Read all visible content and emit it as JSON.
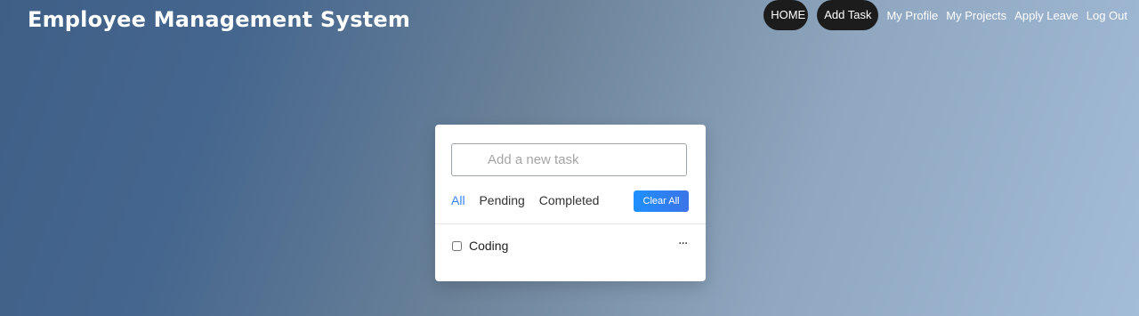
{
  "header": {
    "title": "Employee Management System",
    "nav": {
      "home": "HOME",
      "add_task": "Add Task",
      "my_profile": "My Profile",
      "my_projects": "My Projects",
      "apply_leave": "Apply Leave",
      "log_out": "Log Out"
    }
  },
  "todo": {
    "input_placeholder": "Add a new task",
    "filters": [
      "All",
      "Pending",
      "Completed"
    ],
    "active_filter": "All",
    "clear_label": "Clear All",
    "tasks": [
      {
        "label": "Coding",
        "checked": false
      }
    ],
    "menu_icon": "ellipsis-icon"
  },
  "colors": {
    "accent": "#3b82f6",
    "nav_pill": "#1c1c1c"
  }
}
